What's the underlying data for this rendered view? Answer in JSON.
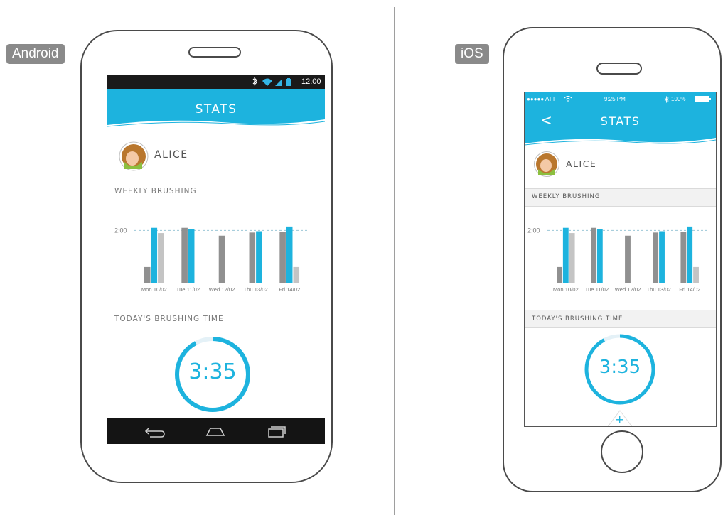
{
  "labels": {
    "android": "Android",
    "ios": "iOS"
  },
  "colors": {
    "accent": "#1db3de",
    "bar_dark": "#909090",
    "bar_light": "#c4c4c4",
    "status_bar": "#1a1a1a",
    "nav_bar": "#141414"
  },
  "android": {
    "status": {
      "time": "12:00",
      "icons": [
        "bluetooth-icon",
        "wifi-icon",
        "signal-icon",
        "battery-icon"
      ]
    },
    "header": {
      "title": "STATS"
    },
    "user": {
      "name": "ALICE"
    },
    "weekly_section": "WEEKLY BRUSHING",
    "today_section": "TODAY'S BRUSHING TIME",
    "timer": {
      "value": "3:35",
      "progress": 0.92
    },
    "nav": [
      "back-icon",
      "home-icon",
      "recent-apps-icon"
    ]
  },
  "ios": {
    "status": {
      "carrier": "●●●●● ATT",
      "time": "9:25 PM",
      "battery": "100%"
    },
    "header": {
      "title": "STATS",
      "back": "<"
    },
    "user": {
      "name": "ALICE"
    },
    "weekly_section": "WEEKLY BRUSHING",
    "today_section": "TODAY'S BRUSHING TIME",
    "timer": {
      "value": "3:35",
      "progress": 0.92
    },
    "add_button": "+"
  },
  "chart_data": {
    "type": "bar",
    "title": "WEEKLY BRUSHING",
    "xlabel": "",
    "ylabel": "",
    "ylim": [
      0,
      2.5
    ],
    "reference_line": {
      "value": 2.0,
      "label": "2:00"
    },
    "categories": [
      "Mon 10/02",
      "Tue 11/02",
      "Wed 12/02",
      "Thu 13/02",
      "Fri 14/02"
    ],
    "days": [
      {
        "bars": [
          {
            "v": 0.6,
            "c": "dark"
          },
          {
            "v": 2.1,
            "c": "accent"
          },
          {
            "v": 1.9,
            "c": "light"
          }
        ]
      },
      {
        "bars": [
          {
            "v": 2.1,
            "c": "dark"
          },
          {
            "v": 2.05,
            "c": "accent"
          }
        ]
      },
      {
        "bars": [
          {
            "v": 1.8,
            "c": "dark"
          }
        ]
      },
      {
        "bars": [
          {
            "v": 1.92,
            "c": "dark"
          },
          {
            "v": 1.97,
            "c": "accent"
          }
        ]
      },
      {
        "bars": [
          {
            "v": 1.95,
            "c": "dark"
          },
          {
            "v": 2.15,
            "c": "accent"
          },
          {
            "v": 0.6,
            "c": "light"
          }
        ]
      }
    ]
  }
}
